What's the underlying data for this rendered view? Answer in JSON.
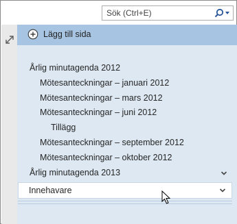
{
  "search": {
    "placeholder": "Sök (Ctrl+E)",
    "icon": "search-icon"
  },
  "toolbar": {
    "add_page_label": "Lägg till sida",
    "add_icon": "plus-circle-icon",
    "expand_icon": "expand-arrows-icon"
  },
  "pages": [
    {
      "label": "Årlig minutagenda 2012",
      "level": 1
    },
    {
      "label": "Mötesanteckningar – januari 2012",
      "level": 2
    },
    {
      "label": "Mötesanteckningar – mars 2012",
      "level": 2
    },
    {
      "label": "Mötesanteckningar – juni 2012",
      "level": 2
    },
    {
      "label": "Tillägg",
      "level": 3
    },
    {
      "label": "Mötesanteckningar – september 2012",
      "level": 2
    },
    {
      "label": "Mötesanteckningar – oktober 2012",
      "level": 2
    },
    {
      "label": "Årlig minutagenda 2013",
      "level": 1
    }
  ],
  "owner": {
    "label": "Innehavare"
  },
  "colors": {
    "panel": "#dde8f2",
    "add_bar": "#a7c5e2",
    "accent": "#2b579a"
  }
}
